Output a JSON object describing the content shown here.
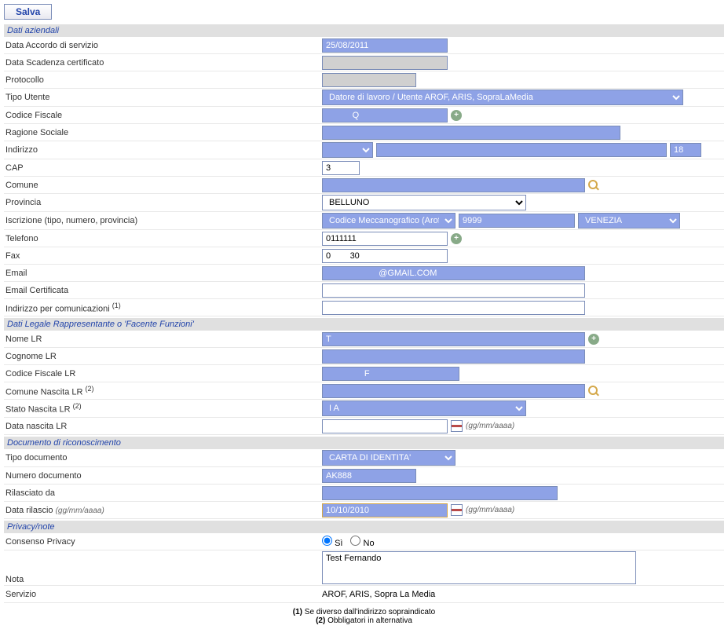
{
  "buttons": {
    "save": "Salva"
  },
  "sections": {
    "aziendali": "Dati aziendali",
    "legale": "Dati Legale Rappresentante o 'Facente Funzioni'",
    "documento": "Documento di riconoscimento",
    "privacy": "Privacy/note"
  },
  "labels": {
    "data_accordo": "Data Accordo di servizio",
    "data_scadenza": "Data Scadenza certificato",
    "protocollo": "Protocollo",
    "tipo_utente": "Tipo Utente",
    "codice_fiscale": "Codice Fiscale",
    "ragione_sociale": "Ragione Sociale",
    "indirizzo": "Indirizzo",
    "cap": "CAP",
    "comune": "Comune",
    "provincia": "Provincia",
    "iscrizione": "Iscrizione (tipo, numero, provincia)",
    "telefono": "Telefono",
    "fax": "Fax",
    "email": "Email",
    "email_cert": "Email Certificata",
    "indirizzo_com": "Indirizzo per comunicazioni ",
    "indirizzo_com_sup": "(1)",
    "nome_lr": "Nome LR",
    "cognome_lr": "Cognome LR",
    "cf_lr": "Codice Fiscale LR",
    "comune_nascita_lr": "Comune Nascita LR ",
    "comune_nascita_lr_sup": "(2)",
    "stato_nascita_lr": "Stato Nascita LR ",
    "stato_nascita_lr_sup": "(2)",
    "data_nascita_lr": "Data nascita LR",
    "tipo_documento": "Tipo documento",
    "numero_documento": "Numero documento",
    "rilasciato_da": "Rilasciato da",
    "data_rilascio": "Data rilascio ",
    "data_rilascio_hint": "(gg/mm/aaaa)",
    "consenso_privacy": "Consenso Privacy",
    "nota": "Nota",
    "servizio": "Servizio"
  },
  "values": {
    "data_accordo": "25/08/2011",
    "data_scadenza": "",
    "protocollo": "",
    "tipo_utente": "Datore di lavoro / Utente AROF, ARIS, SopraLaMedia",
    "codice_fiscale": "           Q",
    "ragione_sociale": "",
    "indirizzo_tipo": "",
    "indirizzo_via": "",
    "indirizzo_num": "18",
    "cap": "3",
    "comune": "",
    "provincia": "BELLUNO",
    "iscrizione_tipo": "Codice Meccanografico (Arof/Ar",
    "iscrizione_num": "9999",
    "iscrizione_prov": "VENEZIA",
    "telefono": "0111111",
    "fax": "0        30",
    "email": "                      @GMAIL.COM",
    "email_cert": "",
    "indirizzo_com": "",
    "nome_lr": "T",
    "cognome_lr": "",
    "cf_lr": "                F",
    "comune_nascita_lr": "",
    "stato_nascita_lr": "I      A",
    "data_nascita_lr": "",
    "tipo_documento": "CARTA DI IDENTITA'",
    "numero_documento": "AK888",
    "rilasciato_da": "",
    "data_rilascio": "10/10/2010",
    "nota": "Test Fernando",
    "servizio": "AROF, ARIS, Sopra La Media"
  },
  "radio": {
    "si": "Sì",
    "no": "No"
  },
  "date_hint": "(gg/mm/aaaa)",
  "footnotes": {
    "n1_label": "(1)",
    "n1_text": " Se diverso dall'indirizzo sopraindicato",
    "n2_label": "(2)",
    "n2_text": " Obbligatori in alternativa"
  }
}
